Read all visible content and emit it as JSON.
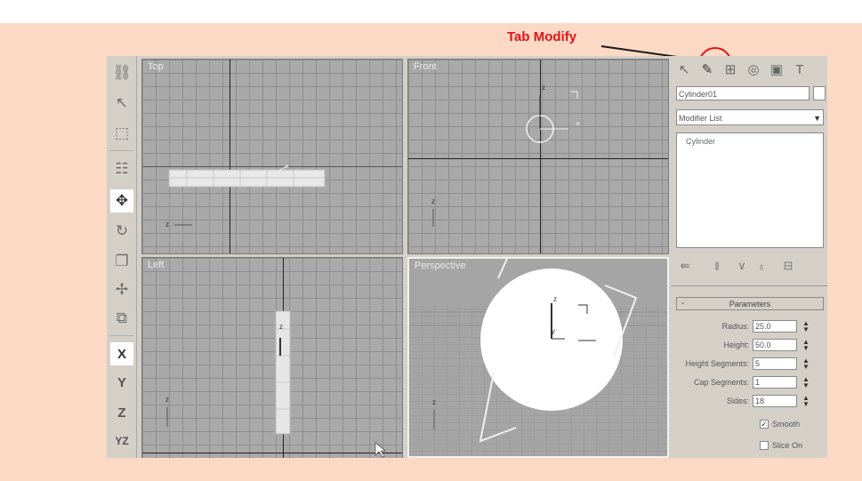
{
  "callout": {
    "label": "Tab Modify"
  },
  "toolbar": {
    "tools": [
      "select-object-icon",
      "select-region-icon",
      "select-by-name-icon",
      "move-icon",
      "rotate-icon",
      "scale-icon",
      "select-manipulate-icon",
      "mirror-icon"
    ],
    "axes": [
      "X",
      "Y",
      "Z",
      "YZ"
    ]
  },
  "viewports": {
    "top": {
      "label": "Top"
    },
    "front": {
      "label": "Front"
    },
    "left": {
      "label": "Left"
    },
    "perspective": {
      "label": "Perspective"
    }
  },
  "command_panel": {
    "tabs": [
      "create-icon",
      "modify-icon",
      "hierarchy-icon",
      "motion-icon",
      "display-icon",
      "utilities-icon"
    ],
    "object_name": "Cylinder01",
    "modifier_list": "Modifier List",
    "stack_items": [
      "Cylinder"
    ],
    "rollout_title": "Parameters",
    "rollout_toggle": "-",
    "parameters": [
      {
        "label": "Radius:",
        "value": "25.0"
      },
      {
        "label": "Height:",
        "value": "50.0"
      },
      {
        "label": "Height Segments:",
        "value": "5"
      },
      {
        "label": "Cap Segments:",
        "value": "1"
      },
      {
        "label": "Sides:",
        "value": "18"
      }
    ],
    "checks": [
      {
        "label": "Smooth",
        "checked": true,
        "mark": "✓"
      },
      {
        "label": "Slice On",
        "checked": false,
        "mark": ""
      }
    ]
  },
  "colors": {
    "callout": "#e3131b",
    "page_bg": "#fbd9c4",
    "ui_gray": "#d4d0c8"
  }
}
